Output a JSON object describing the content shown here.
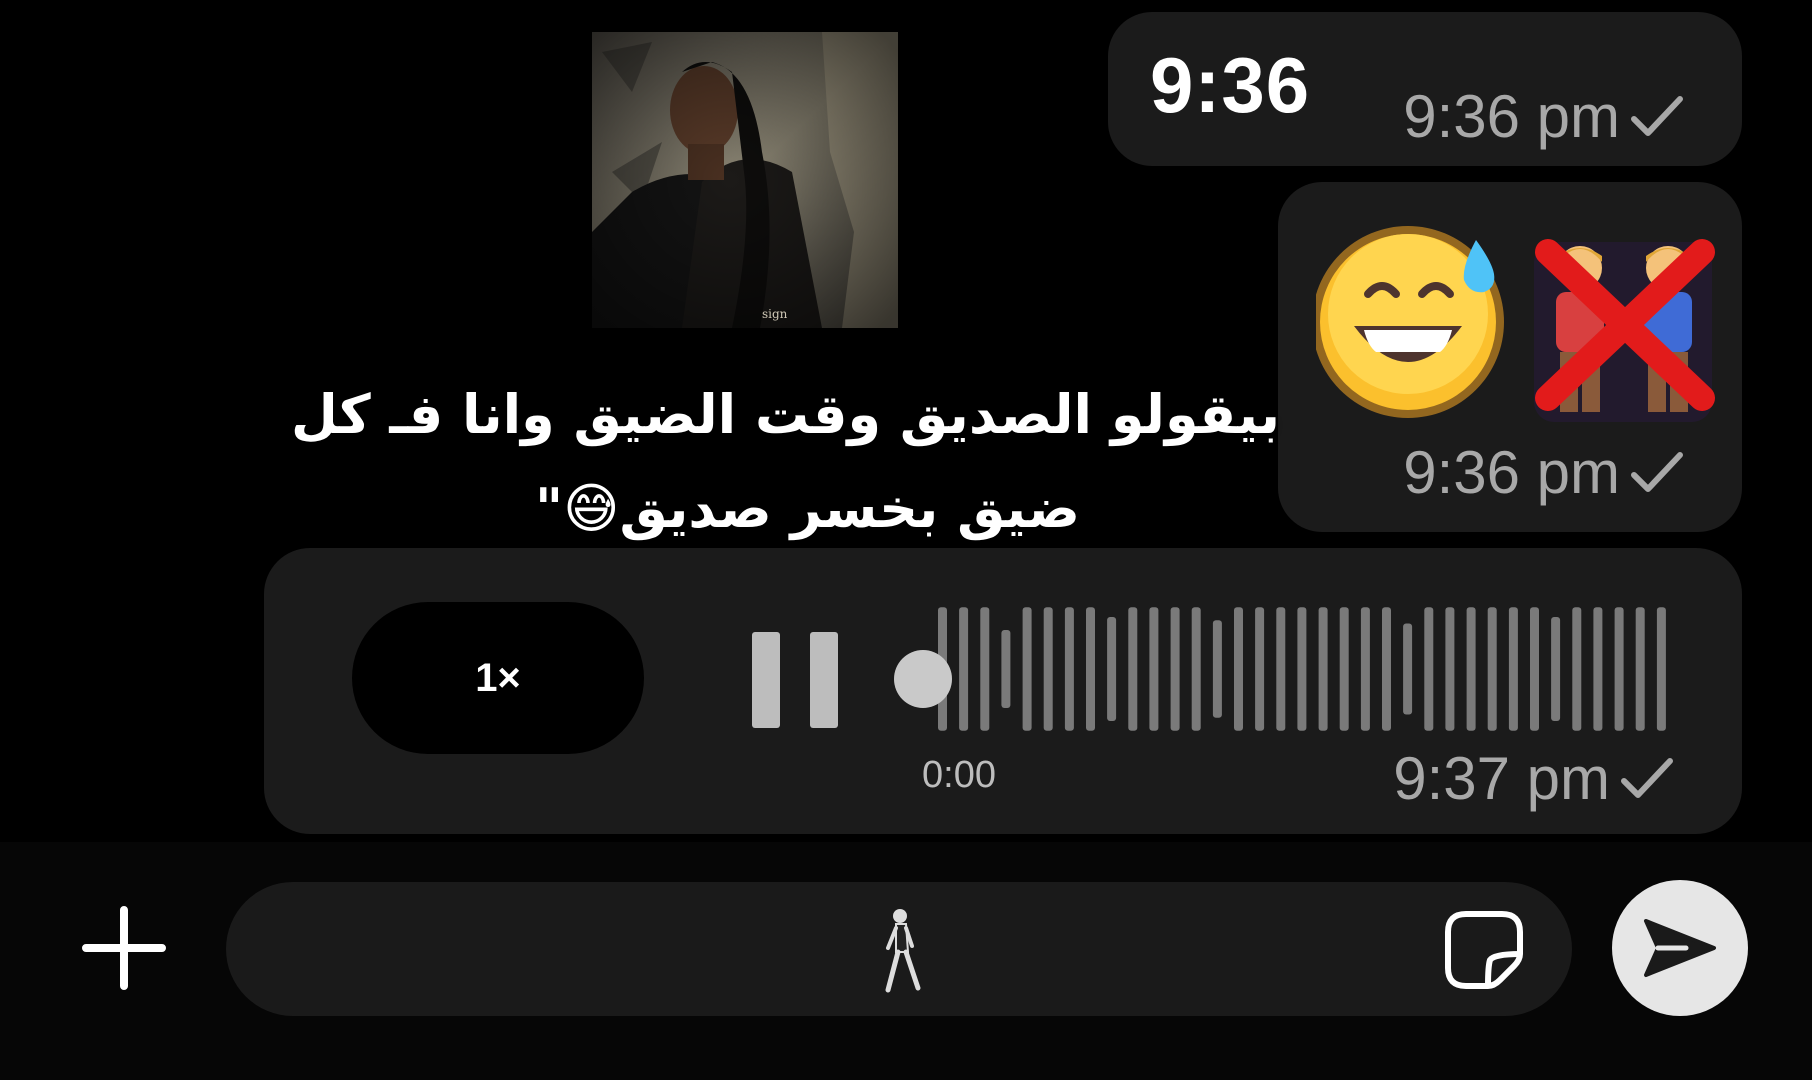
{
  "messages": {
    "time_text": {
      "body": "9:36",
      "timestamp": "9:36 pm"
    },
    "emoji_message": {
      "emojis": [
        "grinning-face-with-sweat-emoji",
        "crossed-out-two-men-holding-hands-emoji"
      ],
      "timestamp": "9:36 pm"
    },
    "photo_caption": {
      "line1": "بيقولو الصديق وقت الضيق وانا فـ كل",
      "line2": "ضيق بخسر صديق😅\""
    },
    "voice_note": {
      "speed_label": "1×",
      "duration": "0:00",
      "timestamp": "9:37 pm",
      "progress": 0
    }
  },
  "composer": {
    "input_value": "",
    "icons": {
      "add": "plus-icon",
      "sticker": "sticker-icon",
      "send": "send-arrow-icon"
    }
  },
  "colors": {
    "background": "#000000",
    "bubble": "#1b1b1b",
    "timestamp": "#a8a8a8",
    "send_button": "#e6e6e6"
  }
}
